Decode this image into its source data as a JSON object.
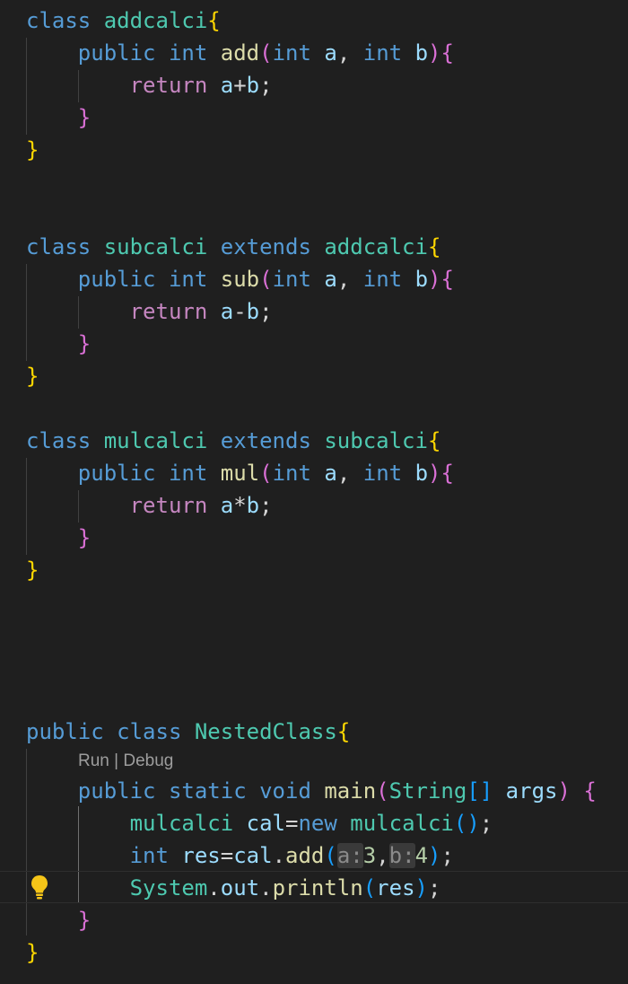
{
  "editor": {
    "codelens": {
      "run": "Run",
      "separator": " | ",
      "debug": "Debug"
    },
    "code": {
      "class1": {
        "kw_class": "class",
        "name": "addcalci",
        "open": "{",
        "method": {
          "kw_public": "public",
          "kw_int": "int",
          "name": "add",
          "paren_open": "(",
          "p1_type": "int",
          "p1_name": "a",
          "comma": ",",
          "p2_type": "int",
          "p2_name": "b",
          "paren_close": ")",
          "brace_open": "{",
          "kw_return": "return",
          "ret_a": "a",
          "op": "+",
          "ret_b": "b",
          "semi": ";",
          "brace_close": "}"
        },
        "close": "}"
      },
      "class2": {
        "kw_class": "class",
        "name": "subcalci",
        "kw_extends": "extends",
        "parent": "addcalci",
        "open": "{",
        "method": {
          "kw_public": "public",
          "kw_int": "int",
          "name": "sub",
          "paren_open": "(",
          "p1_type": "int",
          "p1_name": "a",
          "comma": ",",
          "p2_type": "int",
          "p2_name": "b",
          "paren_close": ")",
          "brace_open": "{",
          "kw_return": "return",
          "ret_a": "a",
          "op": "-",
          "ret_b": "b",
          "semi": ";",
          "brace_close": "}"
        },
        "close": "}"
      },
      "class3": {
        "kw_class": "class",
        "name": "mulcalci",
        "kw_extends": "extends",
        "parent": "subcalci",
        "open": "{",
        "method": {
          "kw_public": "public",
          "kw_int": "int",
          "name": "mul",
          "paren_open": "(",
          "p1_type": "int",
          "p1_name": "a",
          "comma": ",",
          "p2_type": "int",
          "p2_name": "b",
          "paren_close": ")",
          "brace_open": "{",
          "kw_return": "return",
          "ret_a": "a",
          "op": "*",
          "ret_b": "b",
          "semi": ";",
          "brace_close": "}"
        },
        "close": "}"
      },
      "main_class": {
        "kw_public": "public",
        "kw_class": "class",
        "name": "NestedClass",
        "open": "{",
        "main": {
          "kw_public": "public",
          "kw_static": "static",
          "kw_void": "void",
          "name": "main",
          "paren_open": "(",
          "param_type": "String",
          "brackets": "[]",
          "param_name": "args",
          "paren_close": ")",
          "brace_open": "{",
          "brace_close": "}"
        },
        "stmt1": {
          "type": "mulcalci",
          "var": "cal",
          "eq": "=",
          "kw_new": "new",
          "ctor": "mulcalci",
          "paren_open": "(",
          "paren_close": ")",
          "semi": ";"
        },
        "stmt2": {
          "kw_int": "int",
          "var": "res",
          "eq": "=",
          "obj": "cal",
          "dot": ".",
          "method": "add",
          "paren_open": "(",
          "hint_a": "a:",
          "arg1": "3",
          "comma": ",",
          "hint_b": "b:",
          "arg2": "4",
          "paren_close": ")",
          "semi": ";"
        },
        "stmt3": {
          "cls": "System",
          "dot1": ".",
          "field": "out",
          "dot2": ".",
          "method": "println",
          "paren_open": "(",
          "arg": "res",
          "paren_close": ")",
          "semi": ";"
        },
        "close": "}"
      }
    }
  }
}
